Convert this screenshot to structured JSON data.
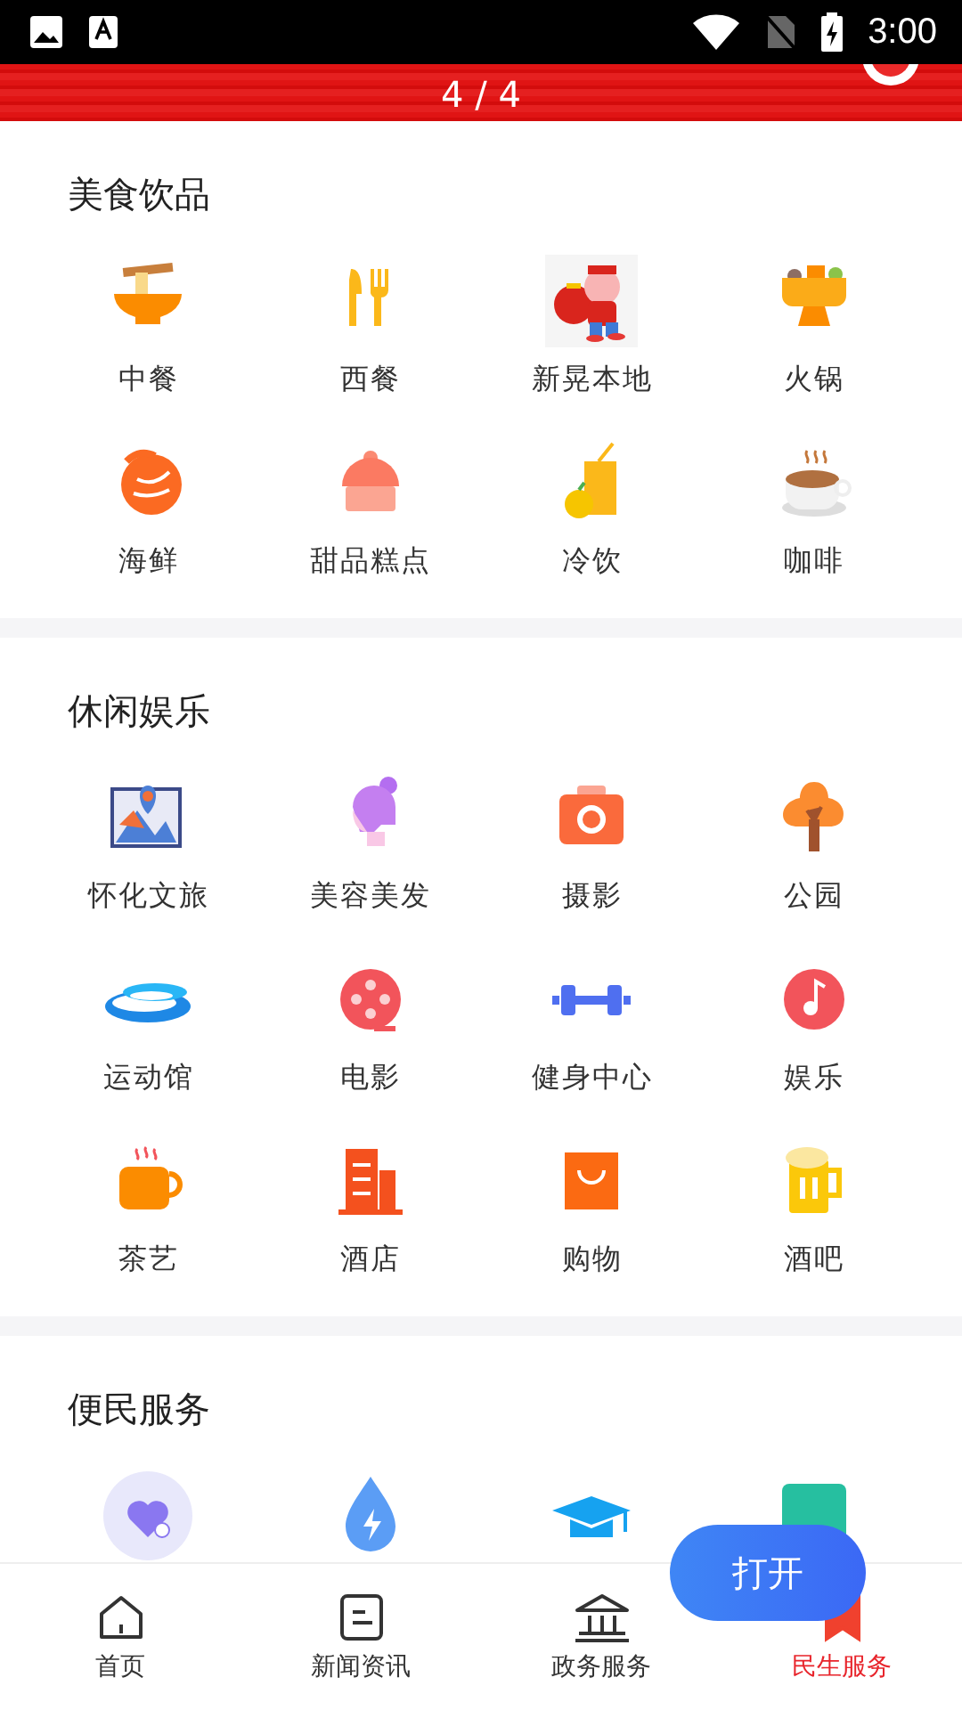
{
  "status_bar": {
    "time": "3:00"
  },
  "header": {
    "counter": "4 / 4"
  },
  "sections": [
    {
      "title": "美食饮品",
      "items": [
        {
          "kind": "icon",
          "label": "中餐"
        },
        {
          "kind": "icon",
          "label": "西餐"
        },
        {
          "kind": "picture",
          "label": "新晃本地"
        },
        {
          "kind": "icon",
          "label": "火锅"
        },
        {
          "kind": "icon",
          "label": "海鲜"
        },
        {
          "kind": "icon",
          "label": "甜品糕点"
        },
        {
          "kind": "icon",
          "label": "冷饮"
        },
        {
          "kind": "icon",
          "label": "咖啡"
        }
      ]
    },
    {
      "title": "休闲娱乐",
      "items": [
        {
          "kind": "icon",
          "label": "怀化文旅"
        },
        {
          "kind": "icon",
          "label": "美容美发"
        },
        {
          "kind": "icon",
          "label": "摄影"
        },
        {
          "kind": "icon",
          "label": "公园"
        },
        {
          "kind": "icon",
          "label": "运动馆"
        },
        {
          "kind": "icon",
          "label": "电影"
        },
        {
          "kind": "icon",
          "label": "健身中心"
        },
        {
          "kind": "icon",
          "label": "娱乐"
        },
        {
          "kind": "icon",
          "label": "茶艺"
        },
        {
          "kind": "icon",
          "label": "酒店"
        },
        {
          "kind": "icon",
          "label": "购物"
        },
        {
          "kind": "icon",
          "label": "酒吧"
        }
      ]
    },
    {
      "title": "便民服务",
      "items": [
        {
          "kind": "icon"
        },
        {
          "kind": "icon"
        },
        {
          "kind": "icon"
        },
        {
          "kind": "icon"
        }
      ]
    }
  ],
  "open_button": {
    "label": "打开"
  },
  "bottom_nav": [
    {
      "label": "首页",
      "selected": false
    },
    {
      "label": "新闻资讯",
      "selected": false
    },
    {
      "label": "政务服务",
      "selected": false
    },
    {
      "label": "民生服务",
      "selected": true
    }
  ]
}
